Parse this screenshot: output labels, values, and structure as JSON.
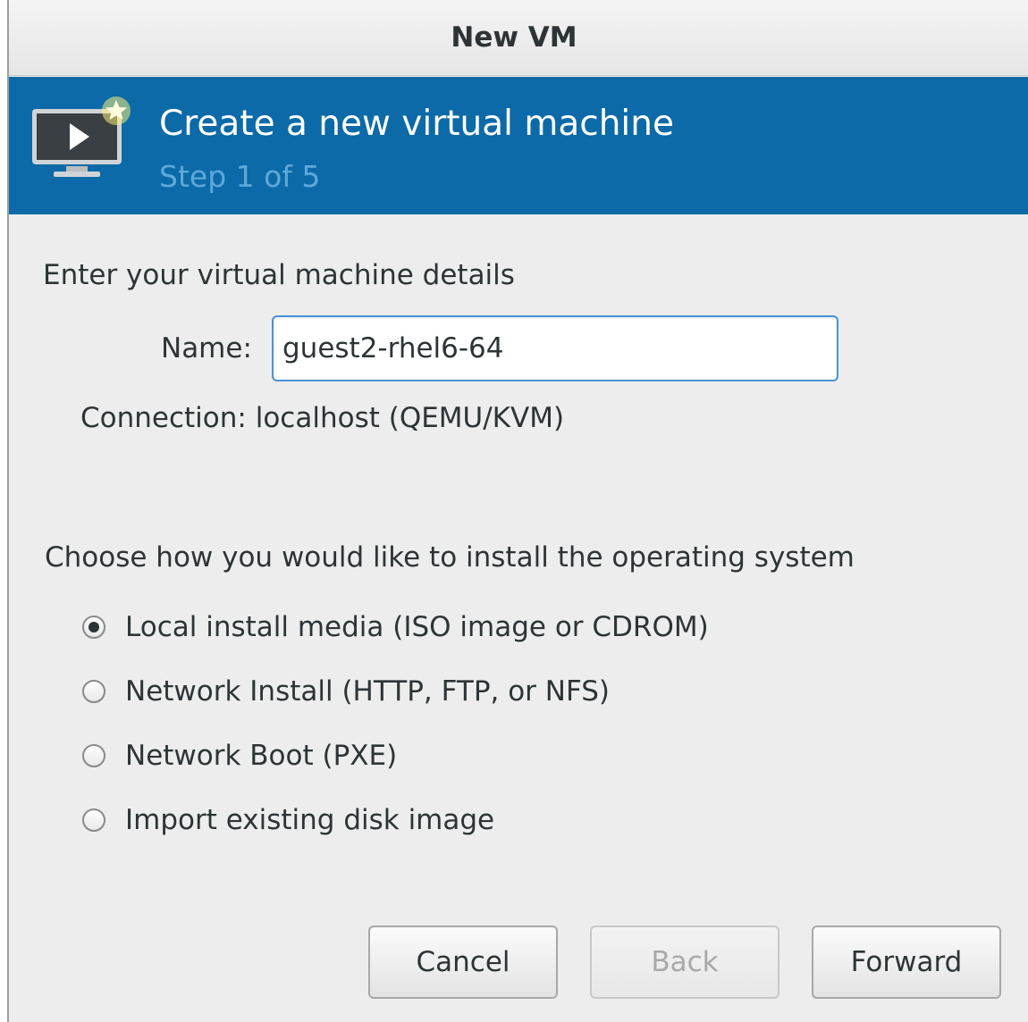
{
  "window": {
    "title": "New VM"
  },
  "banner": {
    "title": "Create a new virtual machine",
    "step": "Step 1 of 5",
    "icon": "new-vm-monitor-icon",
    "background": "#0b6aa7"
  },
  "details": {
    "heading": "Enter your virtual machine details",
    "name_label": "Name:",
    "name_value": "guest2-rhel6-64",
    "connection_label": "Connection:",
    "connection_value": "localhost (QEMU/KVM)"
  },
  "install": {
    "heading": "Choose how you would like to install the operating system",
    "options": [
      {
        "label": "Local install media (ISO image or CDROM)",
        "selected": true
      },
      {
        "label": "Network Install (HTTP, FTP, or NFS)",
        "selected": false
      },
      {
        "label": "Network Boot (PXE)",
        "selected": false
      },
      {
        "label": "Import existing disk image",
        "selected": false
      }
    ]
  },
  "buttons": {
    "cancel": "Cancel",
    "back": "Back",
    "forward": "Forward"
  }
}
